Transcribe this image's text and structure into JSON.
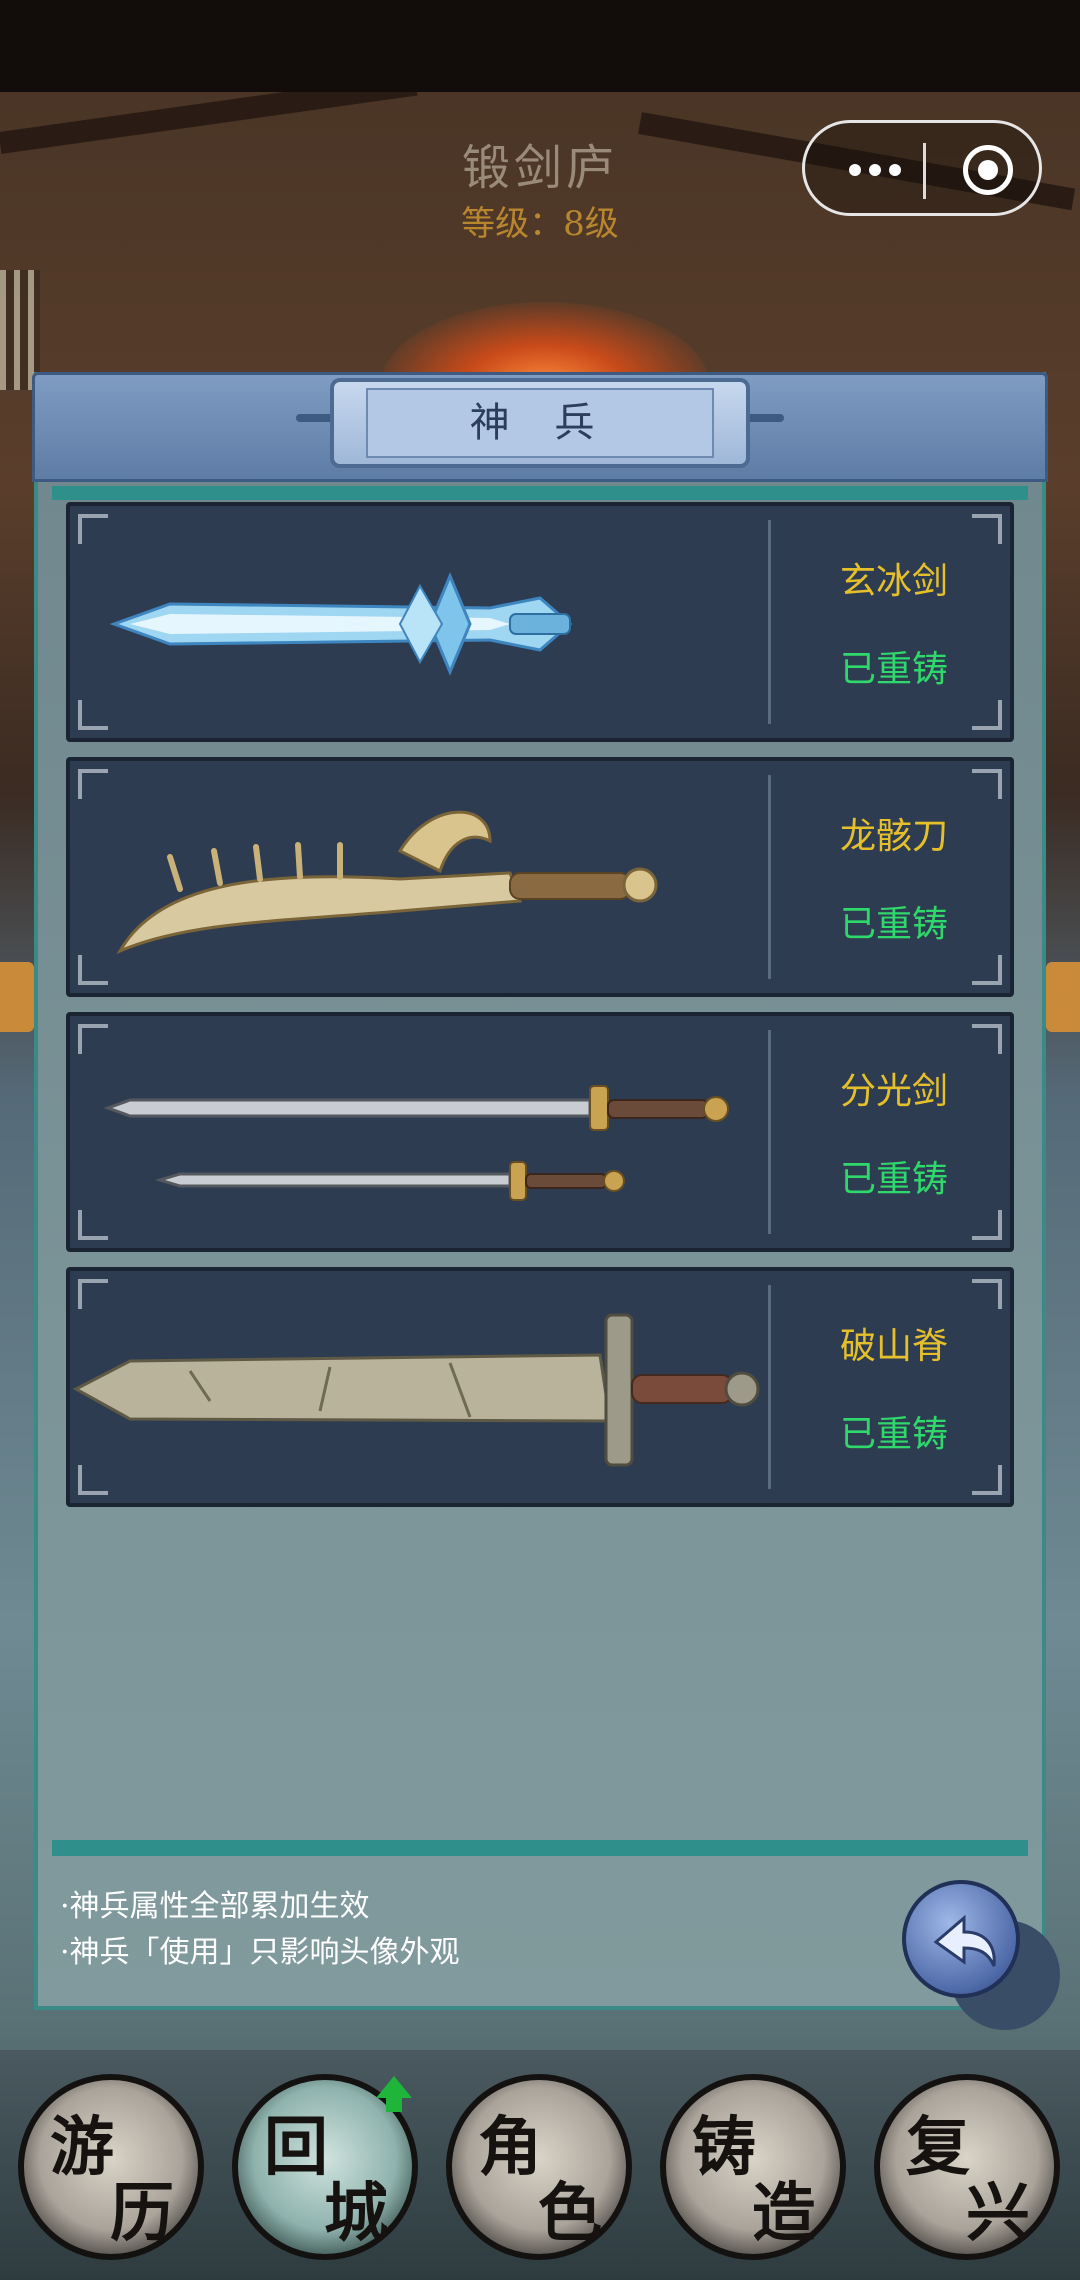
{
  "header": {
    "title": "锻剑庐",
    "level": "等级：8级"
  },
  "panel": {
    "title": "神 兵"
  },
  "weapons": [
    {
      "name": "玄冰剑",
      "status": "已重铸"
    },
    {
      "name": "龙骸刀",
      "status": "已重铸"
    },
    {
      "name": "分光剑",
      "status": "已重铸"
    },
    {
      "name": "破山脊",
      "status": "已重铸"
    }
  ],
  "notes": [
    "·神兵属性全部累加生效",
    "·神兵「使用」只影响头像外观"
  ],
  "bottom_nav": [
    {
      "top": "游",
      "bottom": "历"
    },
    {
      "top": "回",
      "bottom": "城"
    },
    {
      "top": "角",
      "bottom": "色"
    },
    {
      "top": "铸",
      "bottom": "造"
    },
    {
      "top": "复",
      "bottom": "兴"
    }
  ],
  "colors": {
    "weapon_name": "#e6c02a",
    "status_recast": "#2fd86a",
    "panel_border": "#3a8a88"
  }
}
